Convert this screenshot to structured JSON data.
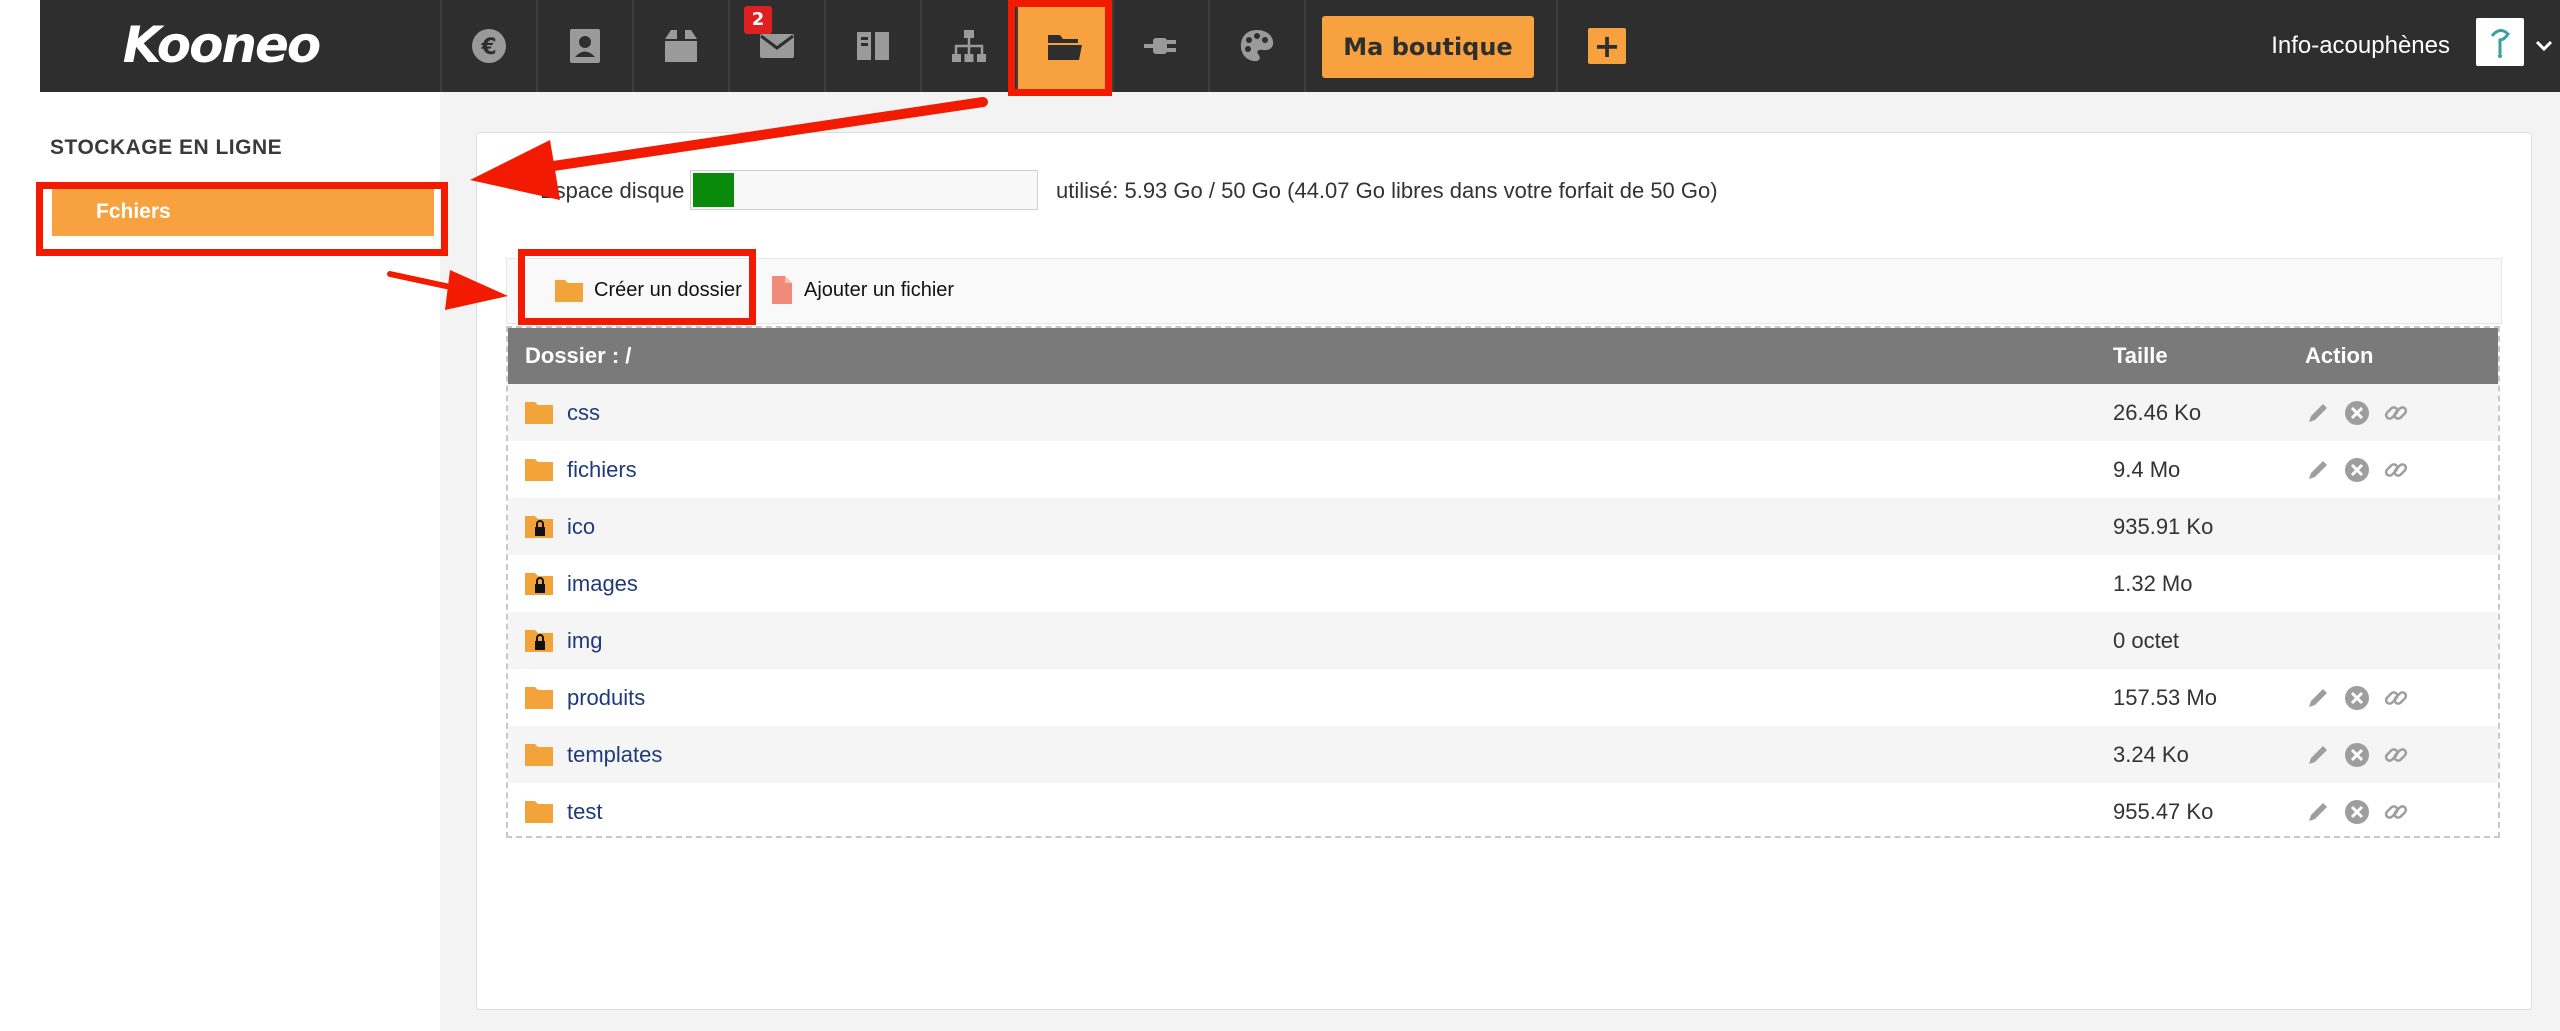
{
  "app": {
    "logo": "Kooneo",
    "mail_badge": "2",
    "shop_button": "Ma boutique",
    "plus_button": "+",
    "user_name": "Info-acouphènes",
    "nav": [
      {
        "name": "euro-icon"
      },
      {
        "name": "contacts-icon"
      },
      {
        "name": "box-icon"
      },
      {
        "name": "mail-icon"
      },
      {
        "name": "book-icon"
      },
      {
        "name": "sitemap-icon"
      },
      {
        "name": "folder-open-icon",
        "active": true
      },
      {
        "name": "plug-icon"
      },
      {
        "name": "palette-icon"
      }
    ]
  },
  "sidebar": {
    "title": "STOCKAGE EN LIGNE",
    "items": [
      {
        "label": "Fchiers",
        "active": true
      }
    ]
  },
  "disk": {
    "label": "Espace disque",
    "info": "utilisé: 5.93 Go / 50 Go (44.07 Go libres dans votre forfait de 50 Go)",
    "used_fraction": 0.1186
  },
  "toolbar": {
    "create_folder": "Créer un dossier",
    "add_file": "Ajouter un fichier"
  },
  "table": {
    "headers": {
      "folder": "Dossier : /",
      "size": "Taille",
      "action": "Action"
    },
    "rows": [
      {
        "name": "css",
        "size": "26.46 Ko",
        "locked": false,
        "actions": true
      },
      {
        "name": "fichiers",
        "size": "9.4 Mo",
        "locked": false,
        "actions": true
      },
      {
        "name": "ico",
        "size": "935.91 Ko",
        "locked": true,
        "actions": false
      },
      {
        "name": "images",
        "size": "1.32 Mo",
        "locked": true,
        "actions": false
      },
      {
        "name": "img",
        "size": "0 octet",
        "locked": true,
        "actions": false
      },
      {
        "name": "produits",
        "size": "157.53 Mo",
        "locked": false,
        "actions": true
      },
      {
        "name": "templates",
        "size": "3.24 Ko",
        "locked": false,
        "actions": true
      },
      {
        "name": "test",
        "size": "955.47 Ko",
        "locked": false,
        "actions": true
      }
    ]
  },
  "colors": {
    "accent": "#f7a23e",
    "topbar": "#2e2e2e",
    "highlight": "#f21a00",
    "disk_fill": "#0a8a0a",
    "link": "#1f3a7a"
  }
}
